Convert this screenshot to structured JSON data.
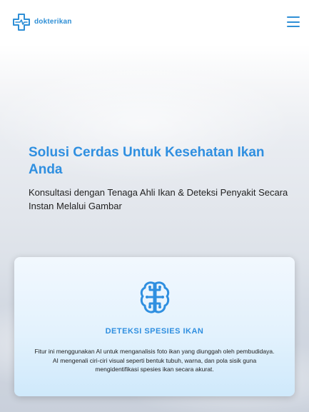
{
  "header": {
    "brand": "dokterikan",
    "logo_icon": "medical-cross-logo-icon",
    "menu_icon": "hamburger-menu-icon"
  },
  "hero": {
    "title": "Solusi Cerdas Untuk Kesehatan Ikan Anda",
    "subtitle": "Konsultasi dengan Tenaga Ahli Ikan & Deteksi Penyakit Secara Instan Melalui Gambar"
  },
  "feature_card": {
    "icon": "brain-circuit-icon",
    "title": "DETEKSI SPESIES IKAN",
    "description": "Fitur ini menggunakan AI untuk menganalisis foto ikan yang diunggah oleh pembudidaya. AI mengenali ciri-ciri visual seperti bentuk tubuh, warna, dan pola sisik guna mengidentifikasi spesies ikan secara akurat."
  },
  "colors": {
    "accent": "#2f8fe0",
    "brand": "#2f8fd6",
    "text": "#222222",
    "card_bg": "#e3f2fd"
  }
}
